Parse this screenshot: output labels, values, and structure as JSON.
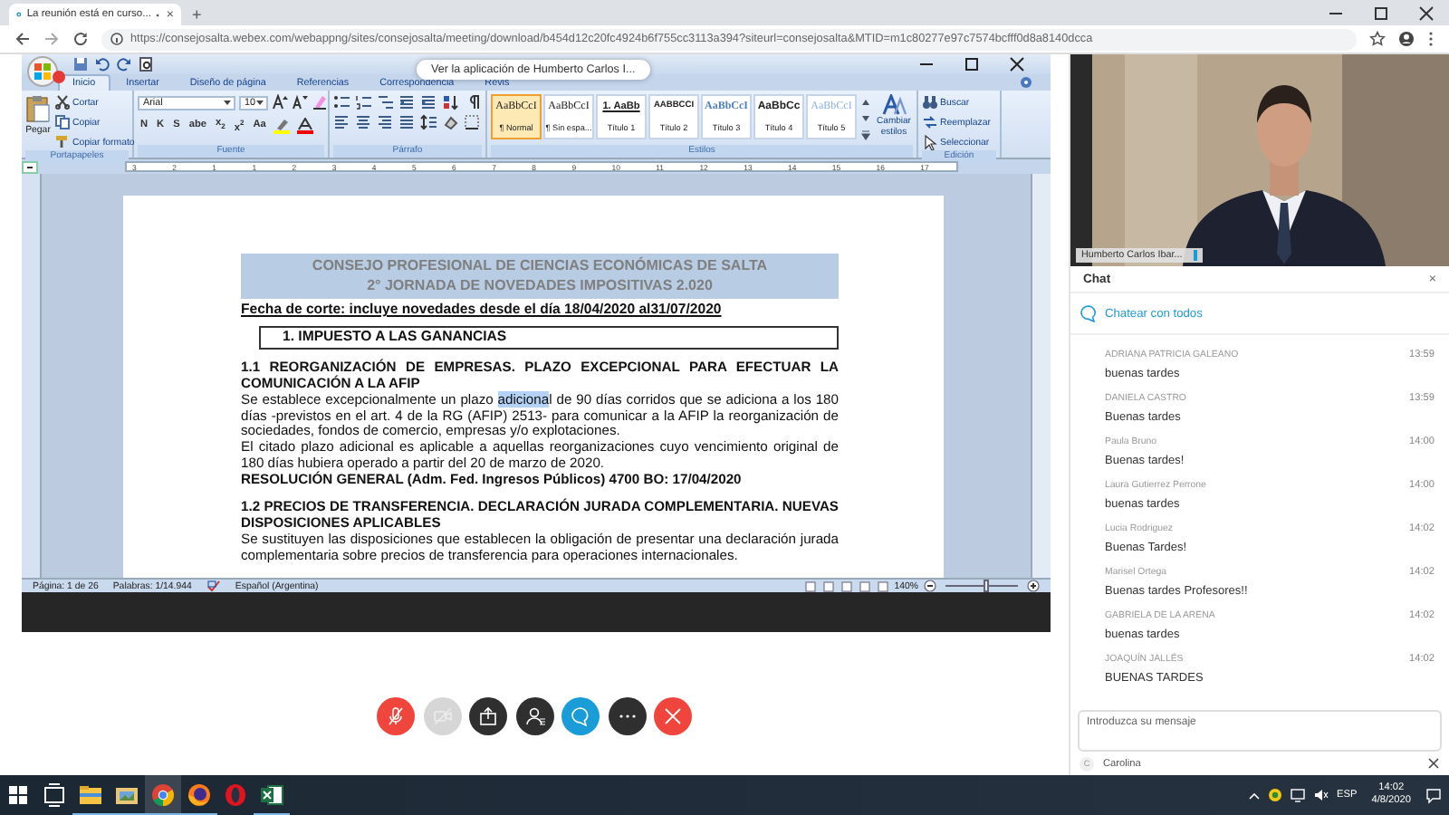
{
  "browser": {
    "tab_title": "La reunión está en curso...",
    "tab_close": "×",
    "new_tab": "+",
    "url": "https://consejosalta.webex.com/webappng/sites/consejosalta/meeting/download/b454d12c20fc4924b6f755cc3113a394?siteurl=consejosalta&MTID=m1c80277e97c7574bcfff0d8a8140dcca"
  },
  "shared_screen": {
    "tooltip": "Ver la aplicación de Humberto Carlos I...",
    "word": {
      "ribbon_tabs": [
        {
          "label": "Inicio",
          "selected": true
        },
        {
          "label": "Insertar",
          "selected": false
        },
        {
          "label": "Diseño de página",
          "selected": false
        },
        {
          "label": "Referencias",
          "selected": false
        },
        {
          "label": "Correspondencia",
          "selected": false
        },
        {
          "label": "Revis",
          "selected": false
        }
      ],
      "clipboard": {
        "paste": "Pegar",
        "items": [
          "Cortar",
          "Copiar",
          "Copiar formato"
        ],
        "label": "Portapapeles"
      },
      "font": {
        "name": "Arial",
        "size": "10",
        "format_buttons": [
          "N",
          "K",
          "S",
          "abe",
          "x$_{2}$",
          "x$^{2}$",
          "Aa"
        ],
        "label": "Fuente"
      },
      "paragraph": {
        "label": "Párrafo"
      },
      "styles": {
        "items": [
          {
            "sample": "AaBbCcI",
            "name": "¶ Normal",
            "kind": "normal",
            "selected": true
          },
          {
            "sample": "AaBbCcI",
            "name": "¶ Sin espa...",
            "kind": "normal",
            "selected": false
          },
          {
            "sample": "1. AaBb",
            "name": "Título 1",
            "kind": "heading",
            "selected": false
          },
          {
            "sample": "AABBCCI",
            "name": "Título 2",
            "kind": "caps",
            "selected": false
          },
          {
            "sample": "AaBbCcI",
            "name": "Título 3",
            "kind": "accent",
            "selected": false
          },
          {
            "sample": "AaBbCc",
            "name": "Título 4",
            "kind": "bold",
            "selected": false
          },
          {
            "sample": "AaBbCcI",
            "name": "Título 5",
            "kind": "light",
            "selected": false
          }
        ],
        "change": "Cambiar estilos",
        "label": "Estilos"
      },
      "editing": {
        "items": [
          "Buscar",
          "Reemplazar",
          "Seleccionar"
        ],
        "label": "Edición"
      },
      "ruler": [
        "3",
        "2",
        "1",
        "1",
        "2",
        "3",
        "4",
        "5",
        "6",
        "7",
        "8",
        "9",
        "10",
        "11",
        "12",
        "13",
        "14",
        "15",
        "16",
        "17"
      ],
      "document": {
        "title_lines": [
          "CONSEJO PROFESIONAL DE CIENCIAS ECONÓMICAS DE SALTA",
          "2° JORNADA DE NOVEDADES IMPOSITIVAS 2.020"
        ],
        "cutoff_date": "Fecha de corte: incluye novedades desde el día 18/04/2020 al31/07/2020",
        "section_heading": "1.   IMPUESTO A LAS GANANCIAS",
        "blocks": [
          {
            "kind": "heading",
            "text": "1.1 REORGANIZACIÓN DE EMPRESAS. PLAZO EXCEPCIONAL PARA EFECTUAR LA COMUNICACIÓN A LA AFIP"
          },
          {
            "kind": "paragraph",
            "segments": [
              {
                "text": "Se establece excepcionalmente un plazo ",
                "selected": false
              },
              {
                "text": "adiciona",
                "selected": true
              },
              {
                "text": "l de 90 días corridos que se adiciona a los 180 días -previstos en el art. 4 de la RG (AFIP) 2513- para comunicar a la AFIP la reorganización de sociedades, fondos de comercio, empresas y/o explotaciones.",
                "selected": false
              }
            ]
          },
          {
            "kind": "paragraph",
            "segments": [
              {
                "text": "El citado plazo adicional es aplicable a aquellas reorganizaciones cuyo vencimiento original de 180 días hubiera operado a partir del 20 de marzo de 2020.",
                "selected": false
              }
            ]
          },
          {
            "kind": "resolution",
            "text": "RESOLUCIÓN GENERAL (Adm. Fed. Ingresos Públicos) 4700 BO: 17/04/2020"
          },
          {
            "kind": "heading",
            "text": "1.2 PRECIOS DE TRANSFERENCIA. DECLARACIÓN JURADA COMPLEMENTARIA. NUEVAS DISPOSICIONES APLICABLES"
          },
          {
            "kind": "paragraph",
            "segments": [
              {
                "text": "Se sustituyen las disposiciones que establecen la obligación de presentar una declaración jurada complementaria sobre precios de transferencia para operaciones internacionales.",
                "selected": false
              }
            ]
          }
        ]
      },
      "status": [
        "Página: 1 de 26",
        "Palabras: 1/14.944",
        "Español (Argentina)"
      ],
      "zoom": "140%",
      "zoom_slider": {
        "level": 0.55
      }
    }
  },
  "video": {
    "name": "Humberto Carlos Ibar..."
  },
  "chat": {
    "title": "Chat",
    "close": "×",
    "audience": "Chatear con todos",
    "messages": [
      {
        "sender": "ADRIANA PATRICIA GALEANO",
        "time": "13:59",
        "text": "buenas tardes"
      },
      {
        "sender": "DANIELA CASTRO",
        "time": "13:59",
        "text": "Buenas tardes"
      },
      {
        "sender": "Paula Bruno",
        "time": "14:00",
        "text": "Buenas tardes!"
      },
      {
        "sender": "Laura Gutierrez Perrone",
        "time": "14:00",
        "text": "buenas tardes"
      },
      {
        "sender": "Lucia Rodriguez",
        "time": "14:02",
        "text": "Buenas Tardes!"
      },
      {
        "sender": "Marisel Ortega",
        "time": "14:02",
        "text": "Buenas tardes Profesores!!"
      },
      {
        "sender": "GABRIELA DE LA ARENA",
        "time": "14:02",
        "text": "buenas tardes"
      },
      {
        "sender": "JOAQUÍN JALLÉS",
        "time": "14:02",
        "text": "BUENAS TARDES"
      }
    ],
    "input": {
      "placeholder": "Introduzca su mensaje"
    },
    "recipient": {
      "initial": "C",
      "name": "Carolina"
    }
  },
  "controls": [
    {
      "kind": "mute",
      "color": "#f0453c",
      "disabled": false
    },
    {
      "kind": "video",
      "color": "#d6d6d6",
      "disabled": true
    },
    {
      "kind": "share",
      "color": "#2f2f2f",
      "disabled": false
    },
    {
      "kind": "participants",
      "color": "#2f2f2f",
      "disabled": false
    },
    {
      "kind": "chat",
      "color": "#1a9cd8",
      "disabled": false
    },
    {
      "kind": "more",
      "color": "#2f2f2f",
      "disabled": false
    },
    {
      "kind": "leave",
      "color": "#f0453c",
      "disabled": false
    }
  ],
  "taskbar": {
    "apps": [
      {
        "kind": "start",
        "running": false,
        "active": false
      },
      {
        "kind": "taskview",
        "running": false,
        "active": false
      },
      {
        "kind": "explorer",
        "running": true,
        "active": false
      },
      {
        "kind": "photos",
        "running": true,
        "active": false
      },
      {
        "kind": "chrome",
        "running": true,
        "active": true
      },
      {
        "kind": "firefox",
        "running": true,
        "active": false
      },
      {
        "kind": "opera",
        "running": false,
        "active": false
      },
      {
        "kind": "excel",
        "running": true,
        "active": false
      }
    ],
    "language": "ESP",
    "time": "14:02",
    "date": "4/8/2020"
  }
}
